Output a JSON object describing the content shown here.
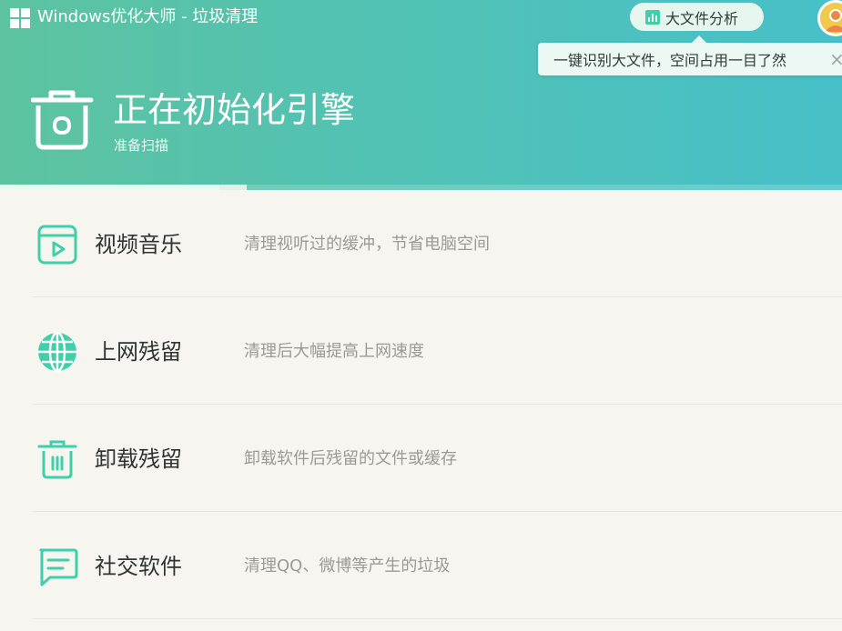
{
  "window": {
    "app_title": "Windows优化大师 - 垃圾清理"
  },
  "header": {
    "bigfile_button_label": "大文件分析",
    "tooltip_text": "一键识别大文件，空间占用一目了然",
    "tooltip_close": "×",
    "status_title": "正在初始化引擎",
    "status_subtitle": "准备扫描",
    "progress_percent": 26
  },
  "colors": {
    "accent": "#3fcfa9",
    "header_start": "#5dc3a0",
    "header_end": "#47c0c8"
  },
  "items": [
    {
      "icon": "video-player-icon",
      "title": "视频音乐",
      "description": "清理视听过的缓冲，节省电脑空间"
    },
    {
      "icon": "globe-icon",
      "title": "上网残留",
      "description": "清理后大幅提高上网速度"
    },
    {
      "icon": "trash-icon",
      "title": "卸载残留",
      "description": "卸载软件后残留的文件或缓存"
    },
    {
      "icon": "chat-bubble-icon",
      "title": "社交软件",
      "description": "清理QQ、微博等产生的垃圾"
    }
  ]
}
